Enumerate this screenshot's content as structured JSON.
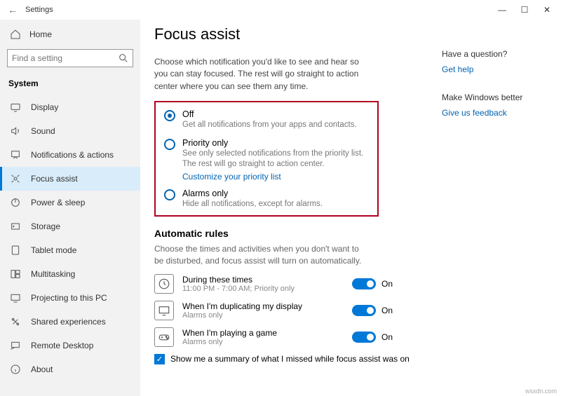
{
  "window": {
    "title": "Settings",
    "minimize": "—",
    "maximize": "☐",
    "close": "✕"
  },
  "sidebar": {
    "home": "Home",
    "search_placeholder": "Find a setting",
    "group": "System",
    "items": [
      {
        "label": "Display"
      },
      {
        "label": "Sound"
      },
      {
        "label": "Notifications & actions"
      },
      {
        "label": "Focus assist"
      },
      {
        "label": "Power & sleep"
      },
      {
        "label": "Storage"
      },
      {
        "label": "Tablet mode"
      },
      {
        "label": "Multitasking"
      },
      {
        "label": "Projecting to this PC"
      },
      {
        "label": "Shared experiences"
      },
      {
        "label": "Remote Desktop"
      },
      {
        "label": "About"
      }
    ]
  },
  "page": {
    "title": "Focus assist",
    "intro": "Choose which notification you'd like to see and hear so you can stay focused. The rest will go straight to action center where you can see them any time.",
    "radios": {
      "off": {
        "label": "Off",
        "sub": "Get all notifications from your apps and contacts."
      },
      "priority": {
        "label": "Priority only",
        "sub": "See only selected notifications from the priority list. The rest will go straight to action center.",
        "link": "Customize your priority list"
      },
      "alarms": {
        "label": "Alarms only",
        "sub": "Hide all notifications, except for alarms."
      }
    },
    "rules": {
      "title": "Automatic rules",
      "desc": "Choose the times and activities when you don't want to be disturbed, and focus assist will turn on automatically.",
      "items": [
        {
          "title": "During these times",
          "sub": "11:00 PM - 7:00 AM; Priority only",
          "state": "On"
        },
        {
          "title": "When I'm duplicating my display",
          "sub": "Alarms only",
          "state": "On"
        },
        {
          "title": "When I'm playing a game",
          "sub": "Alarms only",
          "state": "On"
        }
      ],
      "summary": "Show me a summary of what I missed while focus assist was on"
    }
  },
  "right": {
    "q": "Have a question?",
    "help": "Get help",
    "better": "Make Windows better",
    "feedback": "Give us feedback"
  },
  "watermark": "wsxdn.com"
}
